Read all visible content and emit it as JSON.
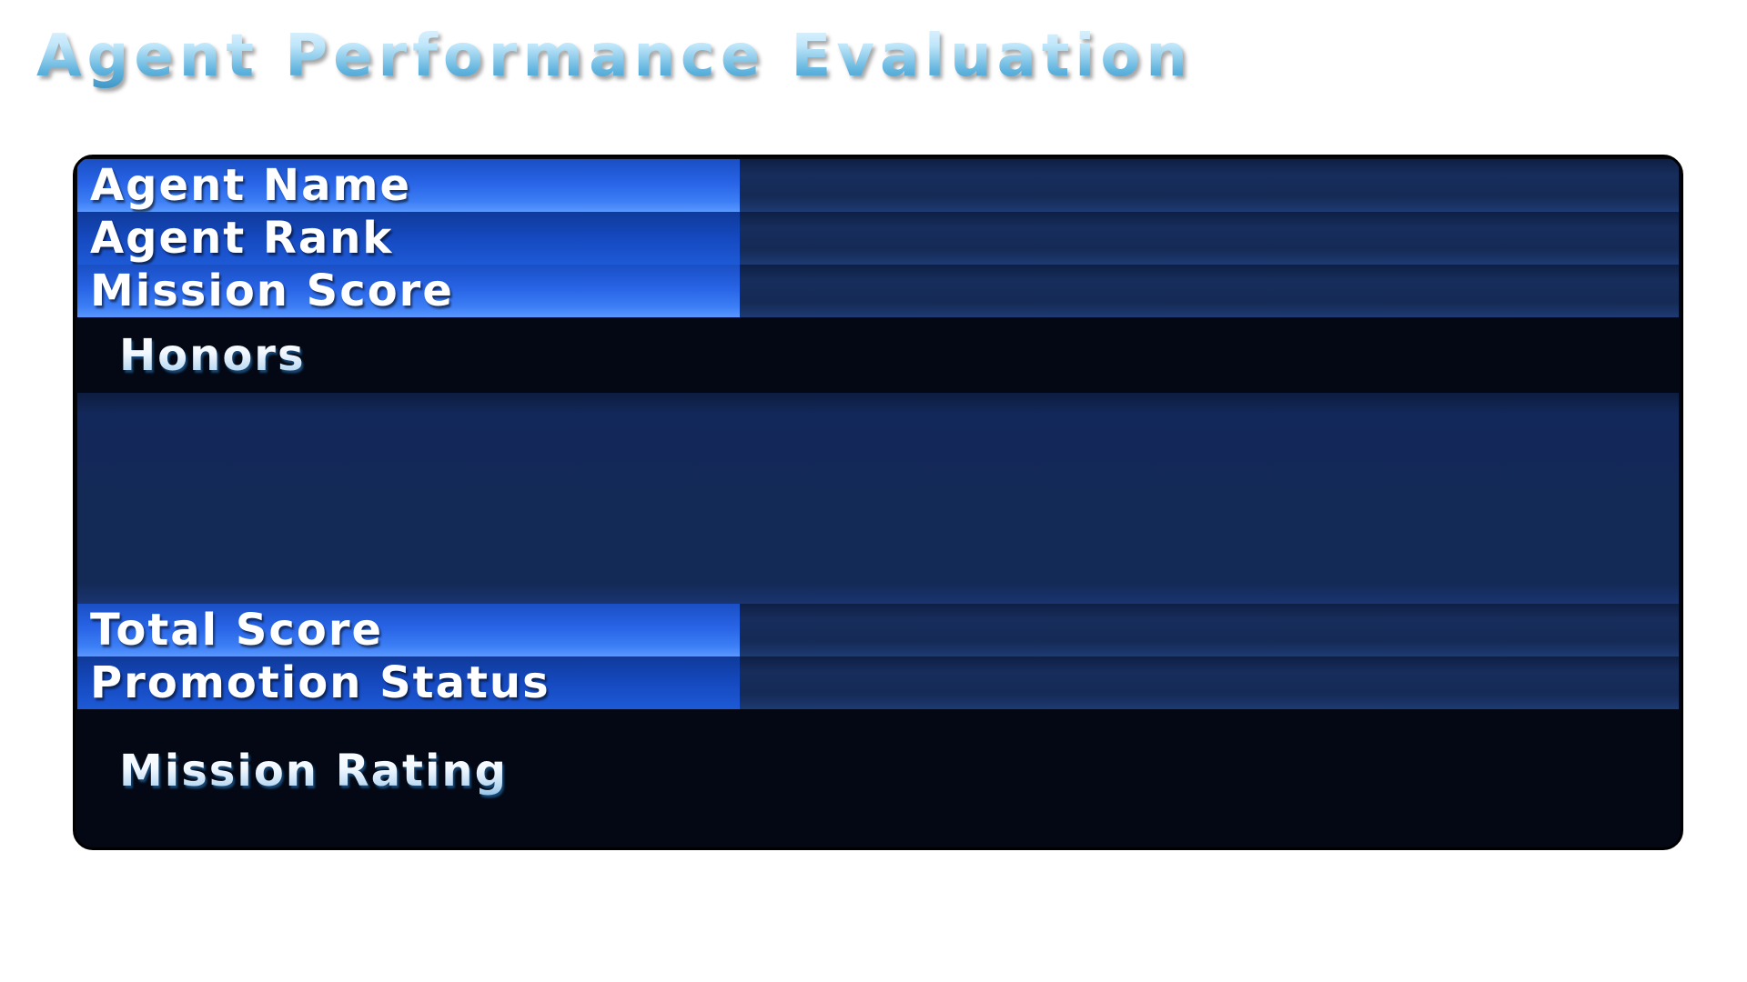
{
  "title": "Agent Performance Evaluation",
  "rows_top": [
    {
      "label": "Agent Name",
      "value": ""
    },
    {
      "label": "Agent Rank",
      "value": ""
    },
    {
      "label": "Mission Score",
      "value": ""
    }
  ],
  "honors": {
    "label": "Honors"
  },
  "rows_bottom": [
    {
      "label": "Total Score",
      "value": ""
    },
    {
      "label": "Promotion Status",
      "value": ""
    }
  ],
  "mission_rating": {
    "label": "Mission Rating"
  }
}
